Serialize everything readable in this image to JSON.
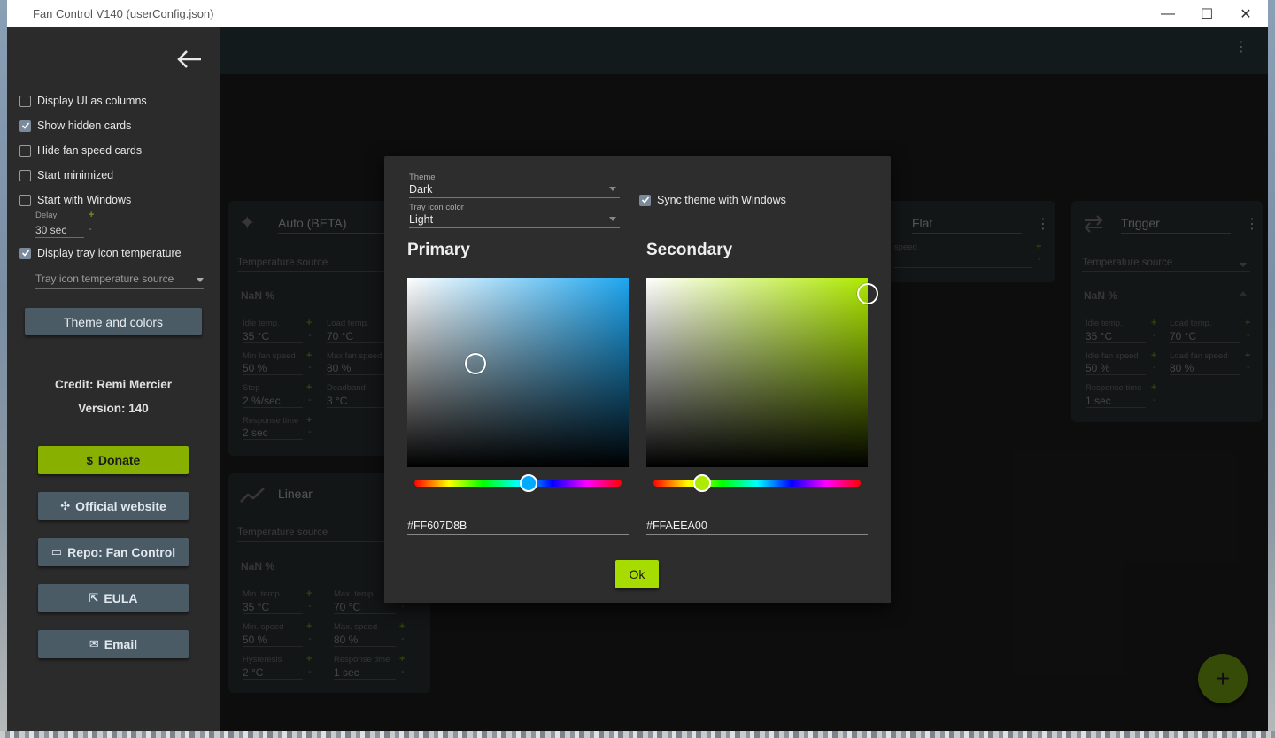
{
  "window": {
    "title": "Fan Control V140 (userConfig.json)",
    "minimize": "—",
    "maximize": "☐",
    "close": "✕"
  },
  "drawer": {
    "options": [
      {
        "label": "Display UI as columns",
        "checked": false
      },
      {
        "label": "Show hidden cards",
        "checked": true
      },
      {
        "label": "Hide fan speed cards",
        "checked": false
      },
      {
        "label": "Start minimized",
        "checked": false
      },
      {
        "label": "Start with Windows",
        "checked": false
      }
    ],
    "delay_label": "Delay",
    "delay_value": "30 sec",
    "tray_temp": {
      "label": "Display tray icon temperature",
      "checked": true
    },
    "tray_source_placeholder": "Tray icon temperature source",
    "theme_button": "Theme and colors",
    "credit": "Credit: Remi Mercier",
    "version": "Version: 140",
    "links": [
      {
        "icon": "$",
        "label": "Donate"
      },
      {
        "icon": "✣",
        "label": "Official website"
      },
      {
        "icon": "▭",
        "label": "Repo: Fan Control"
      },
      {
        "icon": "⇱",
        "label": "EULA"
      },
      {
        "icon": "✉",
        "label": "Email"
      }
    ]
  },
  "cards": {
    "auto": {
      "title": "Auto (BETA)",
      "source": "Temperature source",
      "nan": "NaN %",
      "idle_temp_label": "Idle temp.",
      "idle_temp": "35 °C",
      "load_temp_label": "Load temp.",
      "load_temp": "70 °C",
      "min_speed_label": "Min fan speed",
      "min_speed": "50 %",
      "max_speed_label": "Max fan speed",
      "max_speed": "80 %",
      "step_label": "Step",
      "step": "2 %/sec",
      "deadband_label": "Deadband",
      "deadband": "3 °C",
      "response_label": "Response time",
      "response": "2 sec"
    },
    "linear": {
      "title": "Linear",
      "source": "Temperature source",
      "nan": "NaN %",
      "min_temp_label": "Min. temp.",
      "min_temp": "35 °C",
      "max_temp_label": "Max. temp.",
      "max_temp": "70 °C",
      "min_speed_label": "Min. speed",
      "min_speed": "50 %",
      "max_speed_label": "Max. speed",
      "max_speed": "80 %",
      "hysteresis_label": "Hysteresis",
      "hysteresis": "2 °C",
      "response_label": "Response time",
      "response": "1 sec"
    },
    "flat": {
      "title": "Flat",
      "speed_label": "speed"
    },
    "trigger": {
      "title": "Trigger",
      "source": "Temperature source",
      "nan": "NaN %",
      "idle_temp_label": "Idle temp.",
      "idle_temp": "35 °C",
      "load_temp_label": "Load temp.",
      "load_temp": "70 °C",
      "idle_speed_label": "Idle fan speed",
      "idle_speed": "50 %",
      "load_speed_label": "Load fan speed",
      "load_speed": "80 %",
      "response_label": "Response time",
      "response": "1 sec"
    }
  },
  "dialog": {
    "theme_label": "Theme",
    "theme_value": "Dark",
    "tray_color_label": "Tray icon color",
    "tray_color_value": "Light",
    "sync_label": "Sync theme with Windows",
    "sync_checked": true,
    "primary": {
      "heading": "Primary",
      "hex": "#FF607D8B",
      "hue_color": "#00aaff",
      "picker_color": "#1ea6f0"
    },
    "secondary": {
      "heading": "Secondary",
      "hex": "#FFAEEA00",
      "hue_color": "#aeea00",
      "picker_color": "#aeea00"
    },
    "ok": "Ok"
  },
  "colors": {
    "accent": "#AEEA00",
    "primary": "#607D8B"
  }
}
